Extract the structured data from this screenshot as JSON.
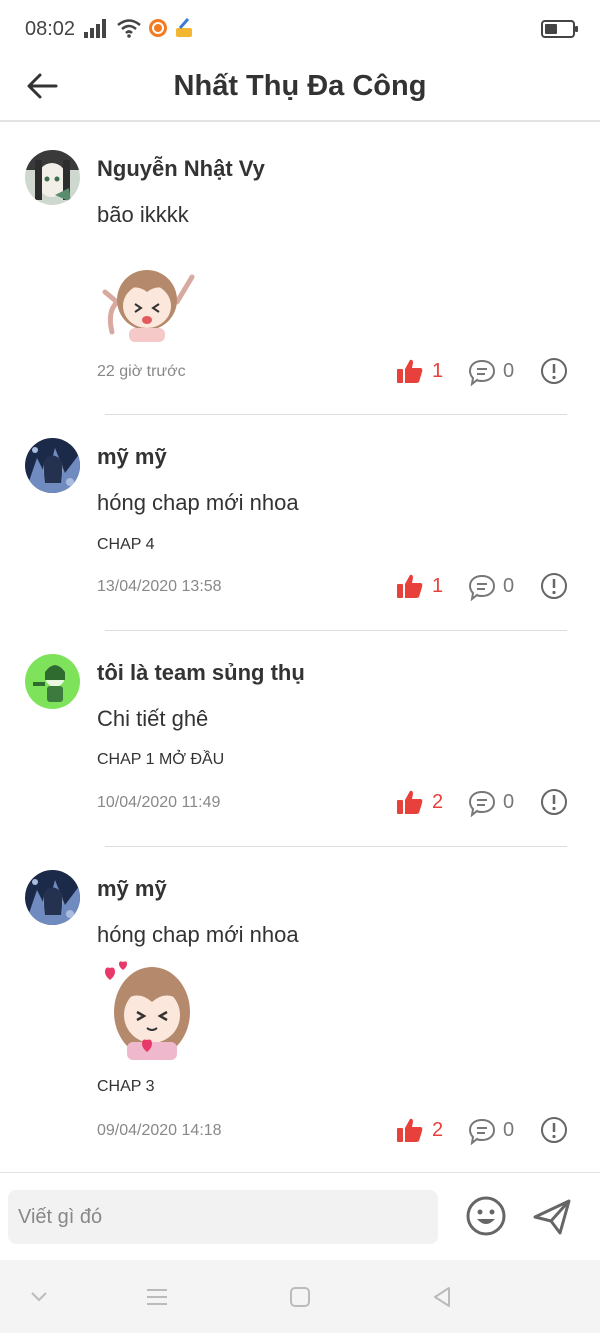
{
  "status_bar": {
    "time": "08:02"
  },
  "header": {
    "title": "Nhất Thụ Đa Công"
  },
  "colors": {
    "like": "#e8403a",
    "muted": "#888888",
    "text": "#333333",
    "divider": "#dedede"
  },
  "icons": {
    "back": "arrow-left-icon",
    "like": "thumbs-up-icon",
    "reply": "chat-bubble-icon",
    "report": "exclamation-circle-icon",
    "emoji": "smiley-icon",
    "send": "paper-plane-icon"
  },
  "comments": [
    {
      "name": "Nguyễn Nhật Vy",
      "text": "bão ikkkk",
      "chapter": "",
      "time": "22 giờ trước",
      "likes": "1",
      "replies": "0",
      "has_sticker": true
    },
    {
      "name": "mỹ mỹ",
      "text": "hóng chap mới nhoa",
      "chapter": "CHAP 4",
      "time": "13/04/2020 13:58",
      "likes": "1",
      "replies": "0",
      "has_sticker": false
    },
    {
      "name": "tôi là team sủng thụ",
      "text": "Chi tiết ghê",
      "chapter": "CHAP 1 MỞ ĐẦU",
      "time": "10/04/2020 11:49",
      "likes": "2",
      "replies": "0",
      "has_sticker": false
    },
    {
      "name": "mỹ mỹ",
      "text": "hóng chap mới nhoa",
      "chapter": "CHAP 3",
      "time": "09/04/2020 14:18",
      "likes": "2",
      "replies": "0",
      "has_sticker": true
    }
  ],
  "composer": {
    "placeholder": "Viết gì đó"
  }
}
